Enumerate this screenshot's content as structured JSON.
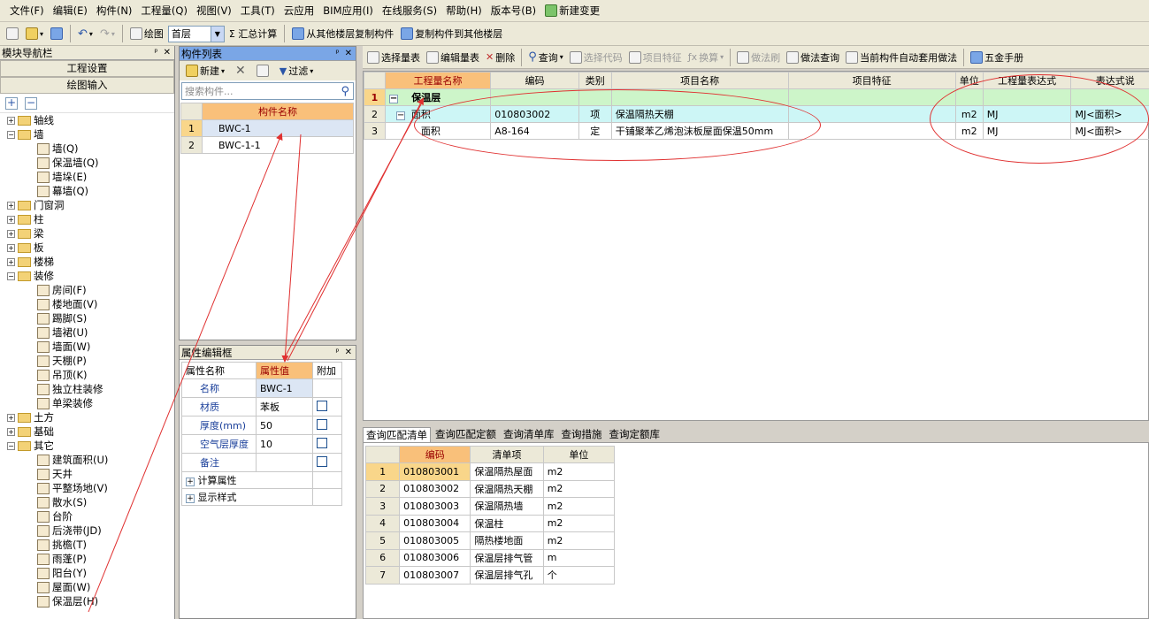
{
  "menu": [
    "文件(F)",
    "编辑(E)",
    "构件(N)",
    "工程量(Q)",
    "视图(V)",
    "工具(T)",
    "云应用",
    "BIM应用(I)",
    "在线服务(S)",
    "帮助(H)",
    "版本号(B)",
    "新建变更"
  ],
  "toolbar1": {
    "draw": "绘图",
    "floor": "首层",
    "sum": "Σ 汇总计算",
    "copy_from": "从其他楼层复制构件",
    "copy_to": "复制构件到其他楼层"
  },
  "nav": {
    "title": "模块导航栏",
    "btn_project": "工程设置",
    "btn_draw": "绘图输入",
    "tree": [
      {
        "label": "轴线",
        "state": "+",
        "children": []
      },
      {
        "label": "墙",
        "state": "-",
        "children": [
          "墙(Q)",
          "保温墙(Q)",
          "墙垛(E)",
          "幕墙(Q)"
        ]
      },
      {
        "label": "门窗洞",
        "state": "+",
        "children": []
      },
      {
        "label": "柱",
        "state": "+",
        "children": []
      },
      {
        "label": "梁",
        "state": "+",
        "children": []
      },
      {
        "label": "板",
        "state": "+",
        "children": []
      },
      {
        "label": "楼梯",
        "state": "+",
        "children": []
      },
      {
        "label": "装修",
        "state": "-",
        "children": [
          "房间(F)",
          "楼地面(V)",
          "踢脚(S)",
          "墙裙(U)",
          "墙面(W)",
          "天棚(P)",
          "吊顶(K)",
          "独立柱装修",
          "单梁装修"
        ]
      },
      {
        "label": "土方",
        "state": "+",
        "children": []
      },
      {
        "label": "基础",
        "state": "+",
        "children": []
      },
      {
        "label": "其它",
        "state": "-",
        "children": [
          "建筑面积(U)",
          "天井",
          "平整场地(V)",
          "散水(S)",
          "台阶",
          "后浇带(JD)",
          "挑檐(T)",
          "雨蓬(P)",
          "阳台(Y)",
          "屋面(W)",
          "保温层(H)"
        ]
      }
    ]
  },
  "comp": {
    "title": "构件列表",
    "new": "新建",
    "filter": "过滤",
    "search_placeholder": "搜索构件...",
    "col": "构件名称",
    "rows": [
      {
        "n": "1",
        "name": "BWC-1"
      },
      {
        "n": "2",
        "name": "BWC-1-1"
      }
    ]
  },
  "props": {
    "title": "属性编辑框",
    "cols": [
      "属性名称",
      "属性值",
      "附加"
    ],
    "rows": [
      {
        "name": "名称",
        "val": "BWC-1",
        "chk": false
      },
      {
        "name": "材质",
        "val": "苯板",
        "chk": true
      },
      {
        "name": "厚度(mm)",
        "val": "50",
        "chk": true
      },
      {
        "name": "空气层厚度",
        "val": "10",
        "chk": true
      },
      {
        "name": "备注",
        "val": "",
        "chk": true
      }
    ],
    "groups": [
      "计算属性",
      "显示样式"
    ]
  },
  "rtool": [
    "选择量表",
    "编辑量表",
    "删除",
    "查询",
    "选择代码",
    "项目特征",
    "换算",
    "做法刷",
    "做法查询",
    "当前构件自动套用做法",
    "五金手册"
  ],
  "upper": {
    "cols": [
      "工程量名称",
      "编码",
      "类别",
      "项目名称",
      "项目特征",
      "单位",
      "工程量表达式",
      "表达式说"
    ],
    "rows": [
      {
        "n": "1",
        "c1": "保温层",
        "c2": "",
        "c3": "",
        "c4": "",
        "c5": "",
        "c6": "",
        "c7": "",
        "c8": ""
      },
      {
        "n": "2",
        "c1": "面积",
        "c2": "010803002",
        "c3": "项",
        "c4": "保温隔热天棚",
        "c5": "",
        "c6": "m2",
        "c7": "MJ",
        "c8": "MJ<面积>"
      },
      {
        "n": "3",
        "c1": "面积",
        "c2": "A8-164",
        "c3": "定",
        "c4": "干铺聚苯乙烯泡沫板屋面保温50mm",
        "c5": "",
        "c6": "m2",
        "c7": "MJ",
        "c8": "MJ<面积>"
      }
    ]
  },
  "lower": {
    "tabs": [
      "查询匹配清单",
      "查询匹配定额",
      "查询清单库",
      "查询措施",
      "查询定额库"
    ],
    "cols": [
      "编码",
      "清单项",
      "单位"
    ],
    "rows": [
      {
        "n": "1",
        "code": "010803001",
        "item": "保温隔热屋面",
        "unit": "m2"
      },
      {
        "n": "2",
        "code": "010803002",
        "item": "保温隔热天棚",
        "unit": "m2"
      },
      {
        "n": "3",
        "code": "010803003",
        "item": "保温隔热墙",
        "unit": "m2"
      },
      {
        "n": "4",
        "code": "010803004",
        "item": "保温柱",
        "unit": "m2"
      },
      {
        "n": "5",
        "code": "010803005",
        "item": "隔热楼地面",
        "unit": "m2"
      },
      {
        "n": "6",
        "code": "010803006",
        "item": "保温层排气管",
        "unit": "m"
      },
      {
        "n": "7",
        "code": "010803007",
        "item": "保温层排气孔",
        "unit": "个"
      }
    ]
  }
}
